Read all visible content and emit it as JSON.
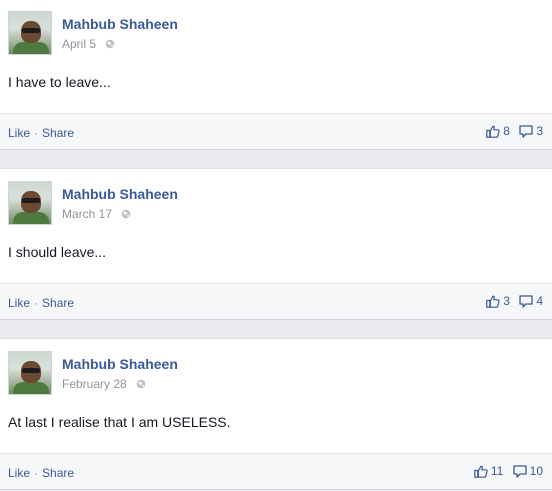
{
  "posts": [
    {
      "author": "Mahbub Shaheen",
      "date": "April 5",
      "message": "I have to leave...",
      "like_label": "Like",
      "share_label": "Share",
      "separator": "·",
      "likes": "8",
      "comments": "3"
    },
    {
      "author": "Mahbub Shaheen",
      "date": "March 17",
      "message": "I should leave...",
      "like_label": "Like",
      "share_label": "Share",
      "separator": "·",
      "likes": "3",
      "comments": "4"
    },
    {
      "author": "Mahbub Shaheen",
      "date": "February 28",
      "message": "At last I realise that I am USELESS.",
      "like_label": "Like",
      "share_label": "Share",
      "separator": "·",
      "likes": "11",
      "comments": "10"
    }
  ],
  "icons": {
    "privacy": "globe-icon",
    "likes": "thumbs-up-icon",
    "comments": "comment-bubble-icon"
  },
  "colors": {
    "link": "#3b5998",
    "meta": "#90949c",
    "feed_background": "#e9eaed"
  }
}
